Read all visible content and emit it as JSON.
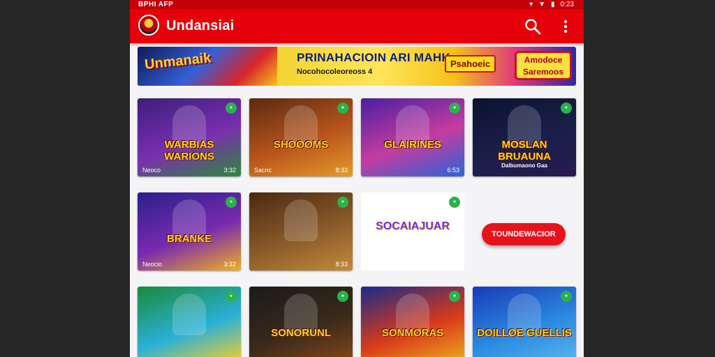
{
  "status_bar": {
    "carrier": "BPHI AFP",
    "time": "0:23"
  },
  "app_bar": {
    "title": "Undansiai"
  },
  "banner": {
    "left_title": "Unmanaik",
    "mid_title": "PRINAHACIOIN ARI MAHK",
    "mid_sub": "Nocohocoleoreoss 4",
    "badge_1": "Psahoeic",
    "badge_2": "Amodoce Saremoos"
  },
  "tiles": [
    {
      "title": "WARBIAS WARIONS",
      "foot_left": "Neoco",
      "foot_right": "3:32",
      "tag": "",
      "colors": [
        "#3b1f7a",
        "#7a2fb0",
        "#2b8a3a"
      ]
    },
    {
      "title": "SHOOOMS",
      "foot_left": "Sacnc",
      "foot_right": "8:33",
      "tag": "",
      "colors": [
        "#5a2a10",
        "#b8551c",
        "#e69a2a"
      ]
    },
    {
      "title": "GLAIRINES",
      "foot_left": "",
      "foot_right": "6:53",
      "tag": "",
      "colors": [
        "#4a1fa0",
        "#c43ca0",
        "#2a65d8"
      ]
    },
    {
      "title": "MOSLAN BRUAUNA",
      "sub": "Dalbumaono Gaa",
      "foot_left": "",
      "foot_right": "",
      "tag": "",
      "colors": [
        "#0c1230",
        "#1a1f4a",
        "#2a1a50"
      ]
    },
    {
      "title": "BRANKE",
      "foot_left": "Neocio",
      "foot_right": "3:32",
      "tag": "",
      "colors": [
        "#2a1f8a",
        "#7a2ab0",
        "#f0b020"
      ]
    },
    {
      "title": "",
      "foot_left": "",
      "foot_right": "8:33",
      "tag": "",
      "colors": [
        "#4a2a12",
        "#8a5a2a",
        "#c48a3a"
      ]
    },
    {
      "title": "SOCAIAJUAR",
      "foot_left": "",
      "foot_right": "",
      "tag": "",
      "colors": [
        "#ffffff",
        "#ffffff",
        "#ffffff"
      ]
    },
    {
      "title": "",
      "foot_left": "",
      "foot_right": "",
      "tag": "",
      "colors": [
        "#ffffff",
        "#ffffff",
        "#ffffff"
      ]
    },
    {
      "title": "",
      "foot_left": "",
      "foot_right": "",
      "tag": "",
      "colors": [
        "#1a8a3a",
        "#2ab0d8",
        "#ffd020"
      ]
    },
    {
      "title": "SONORUNL",
      "foot_left": "",
      "foot_right": "",
      "tag": "",
      "colors": [
        "#1a1a1a",
        "#3a2a1a",
        "#8a4a1a"
      ]
    },
    {
      "title": "SONMORAS",
      "foot_left": "",
      "foot_right": "",
      "tag": "",
      "colors": [
        "#1a2a8a",
        "#d83a1a",
        "#f0b020"
      ]
    },
    {
      "title": "DOILLOE GUELLIS",
      "foot_left": "",
      "foot_right": "",
      "tag": "",
      "colors": [
        "#1a3ab8",
        "#2a8ae0",
        "#5ab8f0"
      ]
    }
  ],
  "action_button": {
    "label": "TOUNDEWACIOR"
  },
  "icons": {
    "search": "search-icon",
    "menu": "more-vert-icon",
    "logo": "app-logo-icon"
  },
  "colors": {
    "primary": "#e60009",
    "status_bar": "#c40008",
    "background": "#f4f4f6"
  }
}
